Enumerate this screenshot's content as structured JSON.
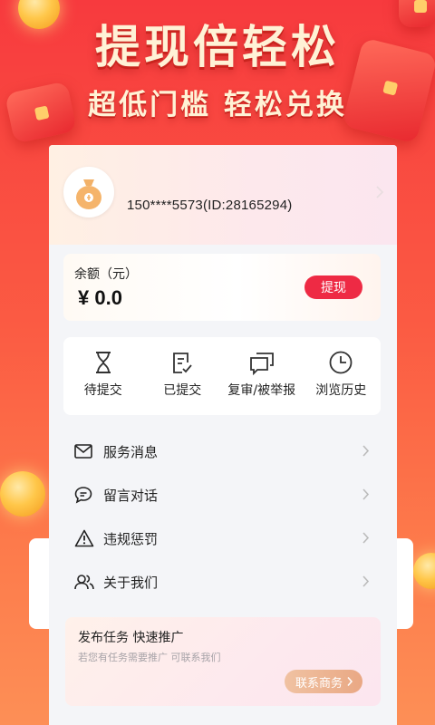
{
  "hero": {
    "title": "提现倍轻松",
    "subtitle": "超低门槛 轻松兑换"
  },
  "profile": {
    "avatar_icon": "money-bag-icon",
    "user_id": "150****5573(ID:28165294)"
  },
  "balance": {
    "label": "余额（元）",
    "value": "¥ 0.0",
    "withdraw_label": "提现"
  },
  "quick_actions": [
    {
      "label": "待提交",
      "icon": "hourglass-icon"
    },
    {
      "label": "已提交",
      "icon": "submitted-doc-icon"
    },
    {
      "label": "复审/被举报",
      "icon": "chat-bubbles-icon"
    },
    {
      "label": "浏览历史",
      "icon": "clock-icon"
    }
  ],
  "menu": [
    {
      "label": "服务消息",
      "icon": "mail-icon"
    },
    {
      "label": "留言对话",
      "icon": "message-icon"
    },
    {
      "label": "违规惩罚",
      "icon": "warning-icon"
    },
    {
      "label": "关于我们",
      "icon": "users-icon"
    }
  ],
  "promo": {
    "title": "发布任务  快速推广",
    "description": "若您有任务需要推广 可联系我们",
    "button_label": "联系商务"
  },
  "colors": {
    "accent": "#ee2a44",
    "background_top": "#f73a3e",
    "background_bottom": "#fd8f56"
  }
}
